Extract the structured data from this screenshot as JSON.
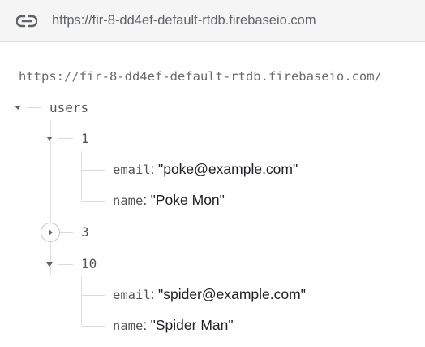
{
  "url_bar": {
    "url": "https://fir-8-dd4ef-default-rtdb.firebaseio.com",
    "icon": "link-icon"
  },
  "tree": {
    "root_url": "https://fir-8-dd4ef-default-rtdb.firebaseio.com/",
    "users": {
      "key": "users",
      "children": [
        {
          "key": "1",
          "expanded": true,
          "fields": [
            {
              "key": "email",
              "value": "\"poke@example.com\""
            },
            {
              "key": "name",
              "value": "\"Poke Mon\""
            }
          ]
        },
        {
          "key": "3",
          "expanded": false,
          "fields": []
        },
        {
          "key": "10",
          "expanded": true,
          "fields": [
            {
              "key": "email",
              "value": "\"spider@example.com\""
            },
            {
              "key": "name",
              "value": "\"Spider Man\""
            }
          ]
        }
      ]
    },
    "separator": ":"
  }
}
